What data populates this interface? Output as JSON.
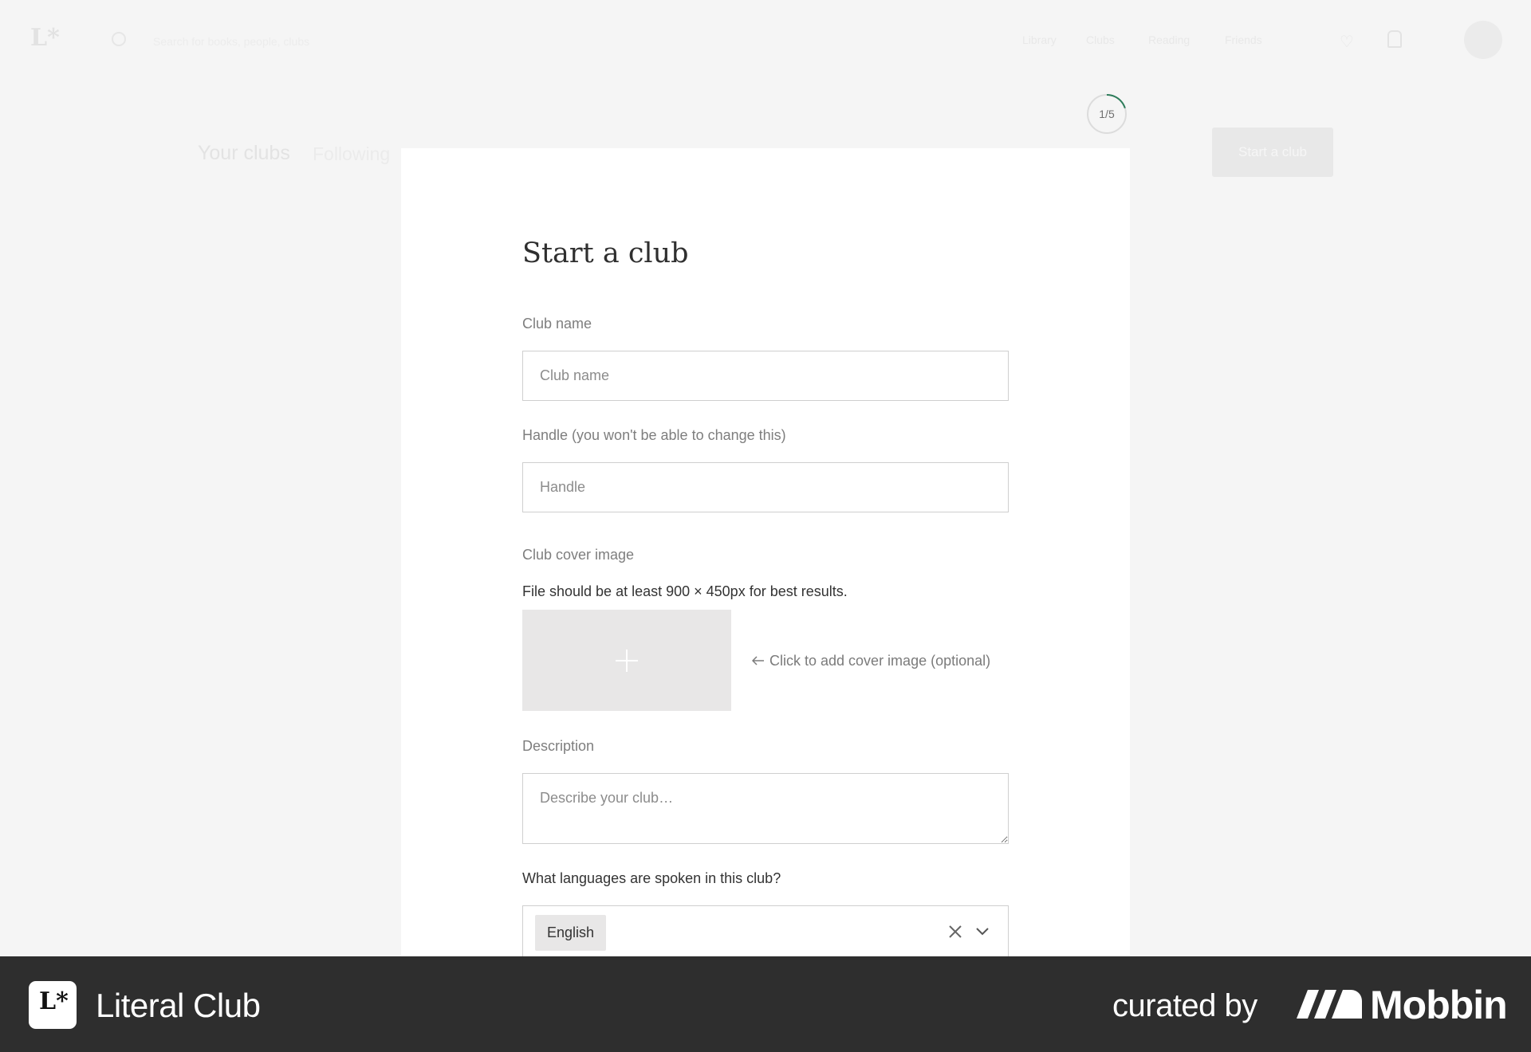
{
  "background": {
    "search_text": "Search for books, people, clubs",
    "nav_items": [
      "Library",
      "Clubs",
      "Reading",
      "Friends"
    ],
    "heading": "Your clubs",
    "tab": "Following",
    "start_button": "Start a club"
  },
  "step": {
    "label": "1/5",
    "current": 1,
    "total": 5
  },
  "modal": {
    "title": "Start a club",
    "club_name": {
      "label": "Club name",
      "placeholder": "Club name",
      "value": ""
    },
    "handle": {
      "label": "Handle (you won't be able to change this)",
      "placeholder": "Handle",
      "value": ""
    },
    "cover": {
      "label": "Club cover image",
      "hint": "File should be at least 900 × 450px for best results.",
      "add_text": "Click to add cover image (optional)",
      "arrow_icon": "arrow-left-icon",
      "plus_icon": "plus-icon"
    },
    "description": {
      "label": "Description",
      "placeholder": "Describe your club…",
      "value": ""
    },
    "languages": {
      "question": "What languages are spoken in this club?",
      "selected": [
        "English"
      ]
    }
  },
  "footer": {
    "app_name": "Literal Club",
    "curated_by": "curated by",
    "brand": "Mobbin"
  },
  "colors": {
    "step_accent": "#2e7d5b",
    "footer_bg": "#2e2e2e"
  }
}
